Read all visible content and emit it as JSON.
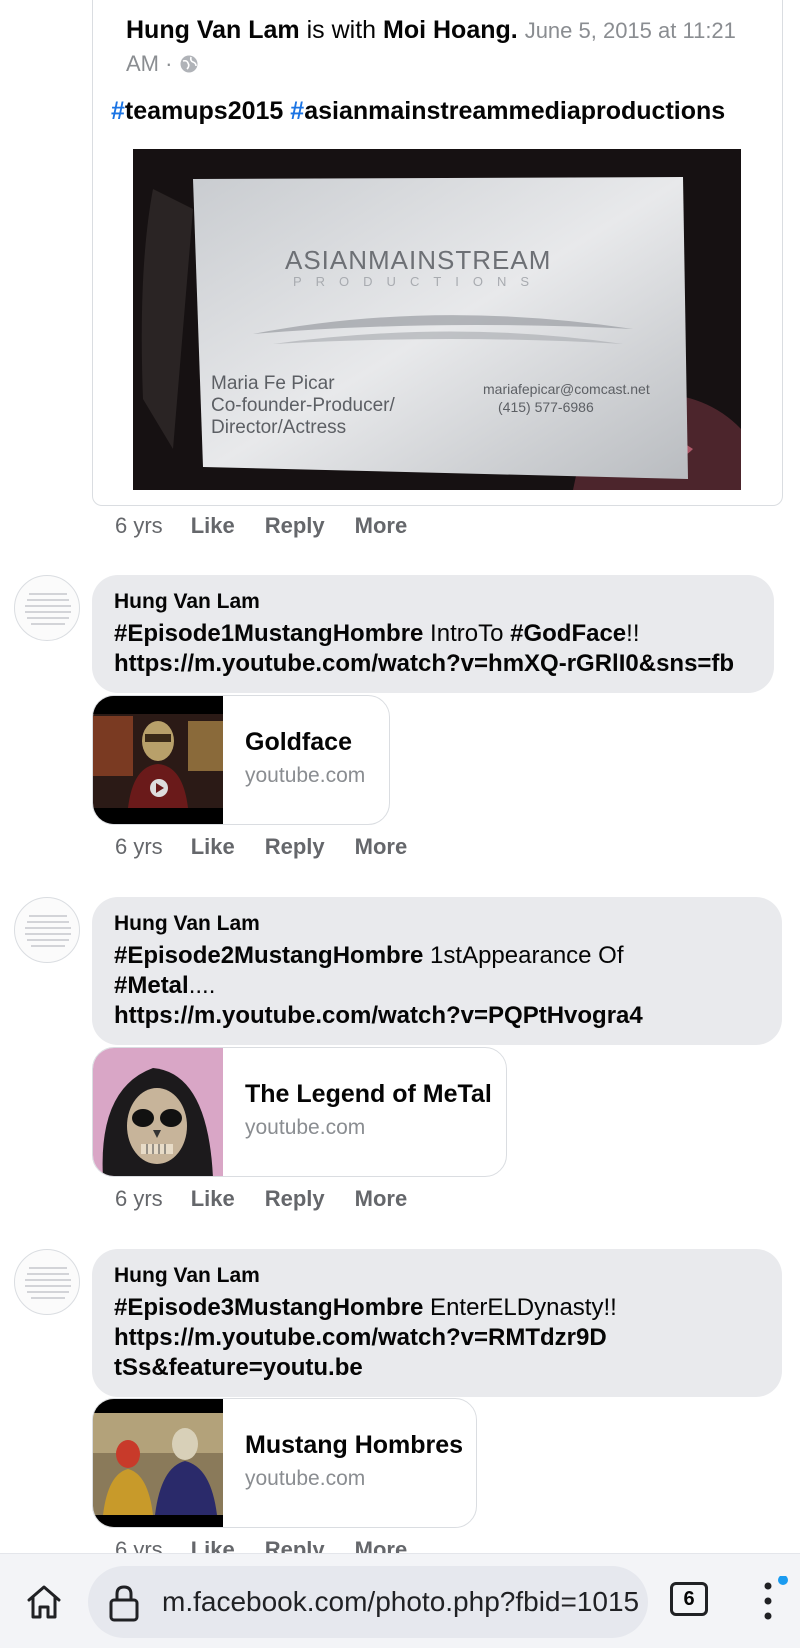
{
  "shared_post": {
    "author": "Hung Van Lam",
    "with_word": "is with",
    "tagged": "Moi Hoang.",
    "timestamp": "June 5, 2015 at 11:21 AM ·",
    "hashtag_1": "teamups2015",
    "hashtag_2": "asianmainstreammediaproductions",
    "photo": {
      "company_line_1": "ASIANMAINSTREAM",
      "company_line_2": "PRODUCTIONS",
      "name": "Maria Fe Picar",
      "title_1": "Co-founder-Producer/",
      "title_2": "Director/Actress",
      "email": "mariafepicar@comcast.net",
      "phone": "(415) 577-6986"
    },
    "actions": {
      "time": "6 yrs",
      "like": "Like",
      "reply": "Reply",
      "more": "More"
    }
  },
  "comments": [
    {
      "author": "Hung Van Lam",
      "tag": "#Episode1MustangHombre",
      "text_mid": " IntroTo ",
      "tag2": "#GodFace",
      "text_end": "!!",
      "url": "https://m.youtube.com/watch?v=hmXQ-rGRlI0&sns=fb",
      "link_title": "Goldface",
      "link_domain": "youtube.com",
      "actions": {
        "time": "6 yrs",
        "like": "Like",
        "reply": "Reply",
        "more": "More"
      }
    },
    {
      "author": "Hung Van Lam",
      "tag": "#Episode2MustangHombre",
      "text_mid": " 1stAppearance Of",
      "tag2": "#Metal",
      "text_end": "....",
      "url": "https://m.youtube.com/watch?v=PQPtHvogra4",
      "link_title": "The Legend of MeTal",
      "link_domain": "youtube.com",
      "actions": {
        "time": "6 yrs",
        "like": "Like",
        "reply": "Reply",
        "more": "More"
      }
    },
    {
      "author": "Hung Van Lam",
      "tag": "#Episode3MustangHombre",
      "text_mid": " EnterELDynasty!!",
      "url_line_1": "https://m.youtube.com/watch?v=RMTdzr9D",
      "url_line_2": "tSs&feature=youtu.be",
      "link_title": "Mustang Hombres",
      "link_domain": "youtube.com",
      "actions": {
        "time": "6 yrs",
        "like": "Like",
        "reply": "Reply",
        "more": "More"
      }
    }
  ],
  "browser": {
    "url": "m.facebook.com/photo.php?fbid=1015",
    "tab_count": "6",
    "icons": [
      "home-icon",
      "lock-icon",
      "tabs-icon",
      "menu-icon"
    ],
    "notification_dot_color": "#1a9bf0"
  },
  "colors": {
    "hashtag_blue": "#1b74e4",
    "bubble_gray": "#e9eaed",
    "meta_gray": "#65676b"
  }
}
